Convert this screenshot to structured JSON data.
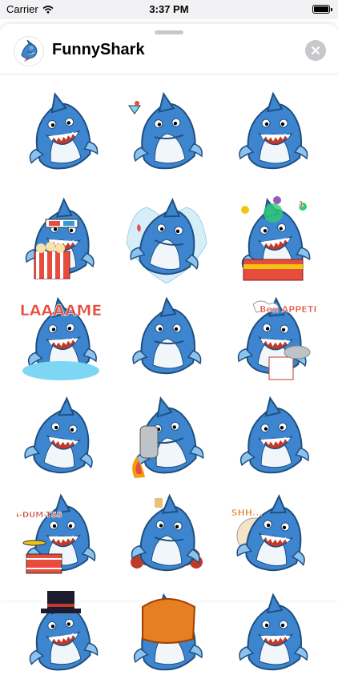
{
  "status_bar": {
    "carrier": "Carrier",
    "time": "3:37 PM",
    "battery_level": 1.0,
    "icons": [
      "wifi-icon",
      "battery-icon"
    ]
  },
  "sheet": {
    "title": "FunnyShark",
    "close_icon": "close-icon"
  },
  "colors": {
    "shark_blue": "#3d86cf",
    "shark_light": "#8cc2ee",
    "belly": "#f1f6fb",
    "outline": "#1f4f80",
    "mouth": "#c0392b",
    "close_bg": "#c7c7cc"
  },
  "stickers": [
    {
      "name": "sticker-grinning-shark"
    },
    {
      "name": "sticker-shark-drinking"
    },
    {
      "name": "sticker-shark-crying-laughing"
    },
    {
      "name": "sticker-shark-3d-popcorn"
    },
    {
      "name": "sticker-shark-heart-rose"
    },
    {
      "name": "sticker-shark-clown-juggler",
      "text": "1"
    },
    {
      "name": "sticker-shark-laaaame",
      "text": "LAAAAME"
    },
    {
      "name": "sticker-shark-unimpressed"
    },
    {
      "name": "sticker-shark-bon-appetit",
      "text": "Bon APPETIT!"
    },
    {
      "name": "sticker-shark-laughing-belly"
    },
    {
      "name": "sticker-shark-jetpack"
    },
    {
      "name": "sticker-shark-facepalm"
    },
    {
      "name": "sticker-shark-drums",
      "text": "BA-DUM-TSS"
    },
    {
      "name": "sticker-shark-poker-table"
    },
    {
      "name": "sticker-shark-shh",
      "text": "SHH..."
    },
    {
      "name": "sticker-shark-top-hat"
    },
    {
      "name": "sticker-shark-orange"
    },
    {
      "name": "sticker-shark-screaming"
    }
  ]
}
